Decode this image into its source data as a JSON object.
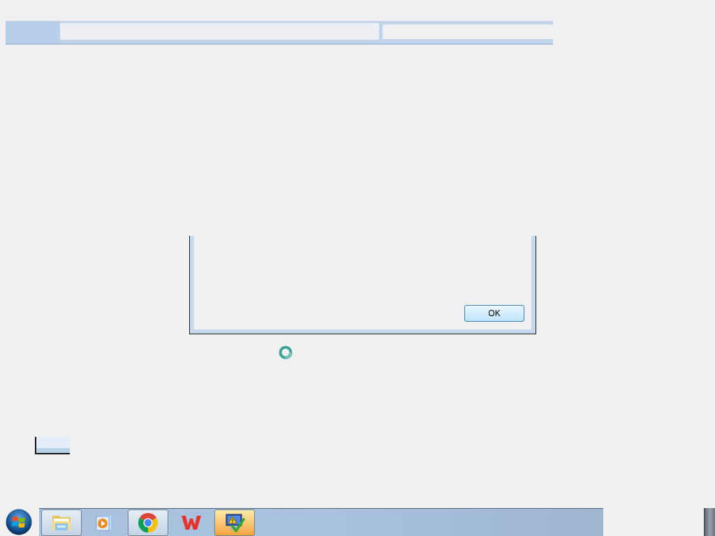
{
  "dialog": {
    "buttons": [
      "OK"
    ]
  },
  "taskbar": {
    "apps": [
      {
        "kind": "folder",
        "running": true,
        "selected": false
      },
      {
        "kind": "media",
        "running": false,
        "selected": false
      },
      {
        "kind": "browser",
        "running": true,
        "selected": false
      },
      {
        "kind": "office",
        "running": false,
        "selected": false
      },
      {
        "kind": "security",
        "running": true,
        "selected": true
      }
    ]
  }
}
